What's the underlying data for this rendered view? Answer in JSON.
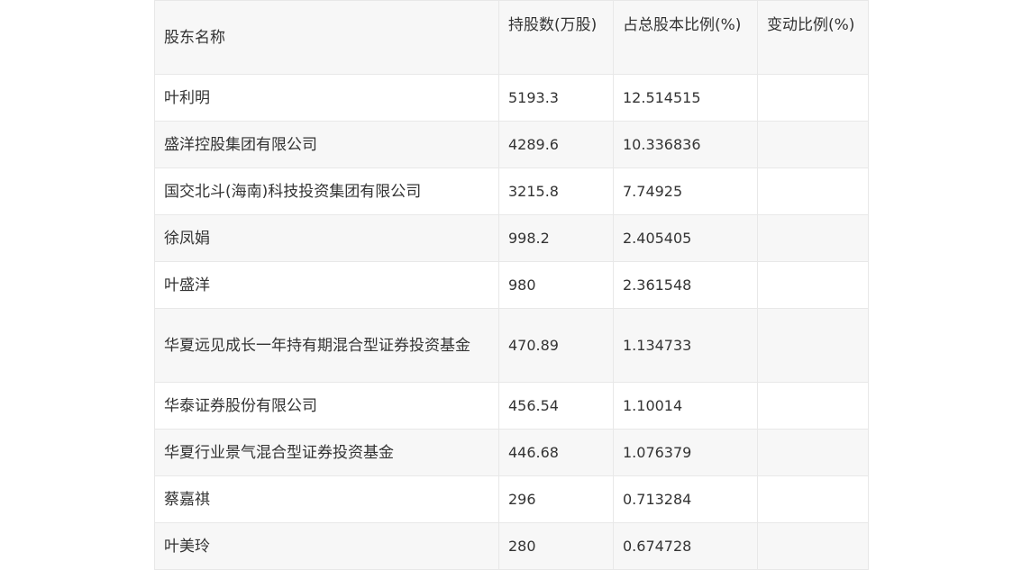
{
  "table": {
    "headers": [
      "股东名称",
      "持股数(万股)",
      "占总股本比例(%)",
      "变动比例(%)"
    ],
    "rows": [
      {
        "name": "叶利明",
        "shares": "5193.3",
        "ratio": "12.514515",
        "change": ""
      },
      {
        "name": "盛洋控股集团有限公司",
        "shares": "4289.6",
        "ratio": "10.336836",
        "change": ""
      },
      {
        "name": "国交北斗(海南)科技投资集团有限公司",
        "shares": "3215.8",
        "ratio": "7.74925",
        "change": ""
      },
      {
        "name": "徐凤娟",
        "shares": "998.2",
        "ratio": "2.405405",
        "change": ""
      },
      {
        "name": "叶盛洋",
        "shares": "980",
        "ratio": "2.361548",
        "change": ""
      },
      {
        "name": "华夏远见成长一年持有期混合型证券投资基金",
        "shares": "470.89",
        "ratio": "1.134733",
        "change": ""
      },
      {
        "name": "华泰证券股份有限公司",
        "shares": "456.54",
        "ratio": "1.10014",
        "change": ""
      },
      {
        "name": "华夏行业景气混合型证券投资基金",
        "shares": "446.68",
        "ratio": "1.076379",
        "change": ""
      },
      {
        "name": "蔡嘉祺",
        "shares": "296",
        "ratio": "0.713284",
        "change": ""
      },
      {
        "name": "叶美玲",
        "shares": "280",
        "ratio": "0.674728",
        "change": ""
      }
    ]
  }
}
